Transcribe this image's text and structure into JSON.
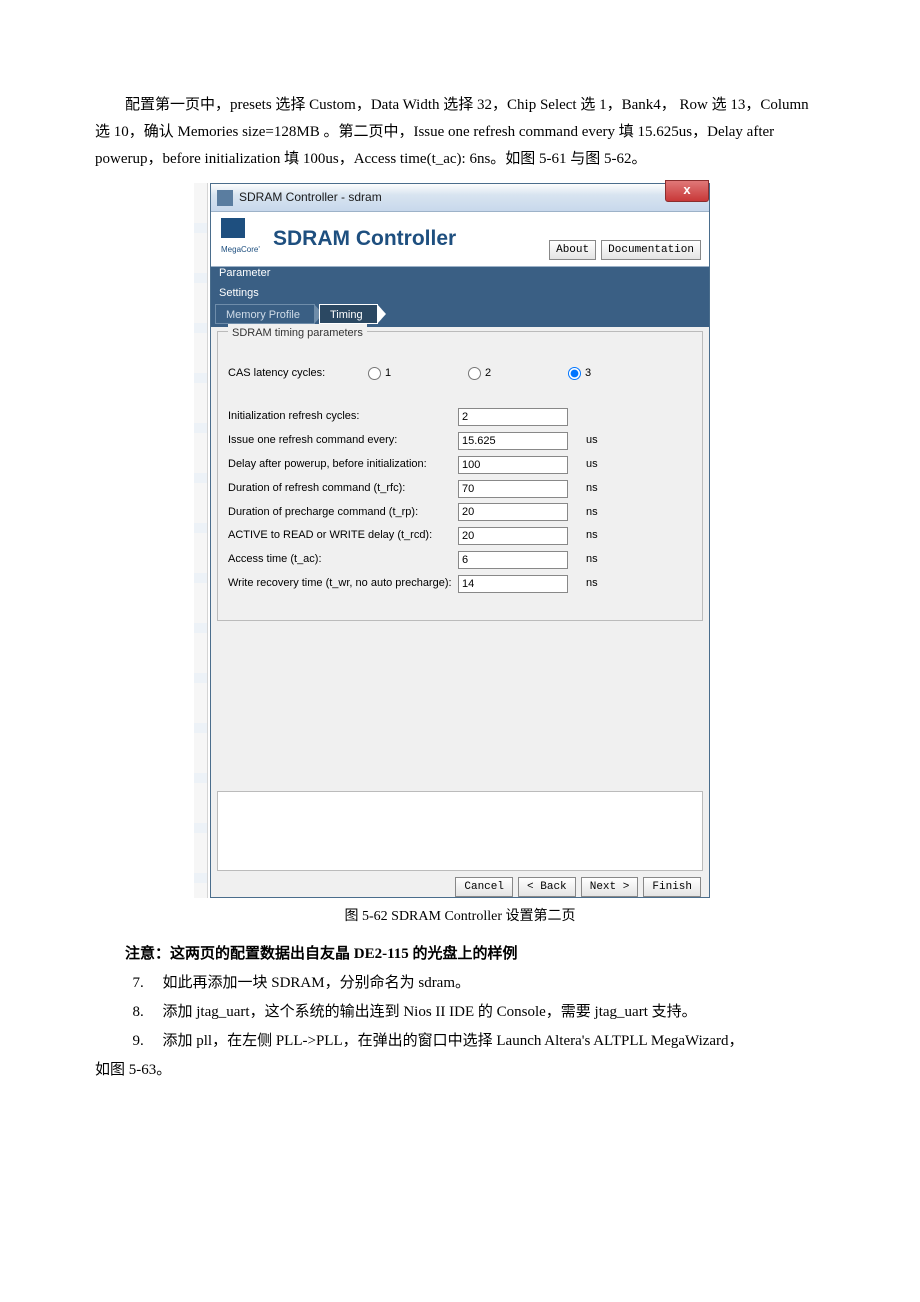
{
  "para1": "配置第一页中，presets 选择 Custom，Data Width 选择 32，Chip Select 选 1，Bank4， Row 选 13，Column 选 10，确认 Memories size=128MB 。第二页中，Issue one refresh command every 填 15.625us，Delay after powerup，before initialization 填 100us，Access time(t_ac): 6ns。如图 5-61 与图 5-62。",
  "dialog": {
    "titlebar": "SDRAM Controller - sdram",
    "close": "x",
    "logo_label": "MegaCore'",
    "big_title": "SDRAM Controller",
    "about_btn": "About",
    "doc_btn": "Documentation",
    "param_settings": "Parameter\nSettings",
    "crumb1": "Memory Profile",
    "crumb2": "Timing",
    "group_title": "SDRAM timing parameters",
    "cas_label": "CAS latency cycles:",
    "opt1": "1",
    "opt2": "2",
    "opt3": "3",
    "rows": [
      {
        "label": "Initialization refresh cycles:",
        "value": "2",
        "unit": ""
      },
      {
        "label": "Issue one refresh command every:",
        "value": "15.625",
        "unit": "us"
      },
      {
        "label": "Delay after powerup, before initialization:",
        "value": "100",
        "unit": "us"
      },
      {
        "label": "Duration of refresh command (t_rfc):",
        "value": "70",
        "unit": "ns"
      },
      {
        "label": "Duration of precharge command (t_rp):",
        "value": "20",
        "unit": "ns"
      },
      {
        "label": "ACTIVE to READ or WRITE delay (t_rcd):",
        "value": "20",
        "unit": "ns"
      },
      {
        "label": "Access time (t_ac):",
        "value": "6",
        "unit": "ns"
      },
      {
        "label": "Write recovery time (t_wr, no auto precharge):",
        "value": "14",
        "unit": "ns"
      }
    ],
    "cancel": "Cancel",
    "back": "< Back",
    "next": "Next >",
    "finish": "Finish"
  },
  "caption": "图 5-62 SDRAM Controller 设置第二页",
  "note": "注意：这两页的配置数据出自友晶 DE2-115 的光盘上的样例",
  "steps": {
    "s7": {
      "n": "7.",
      "t": "如此再添加一块 SDRAM，分别命名为 sdram。"
    },
    "s8": {
      "n": "8.",
      "t": "添加 jtag_uart，这个系统的输出连到 Nios II IDE 的 Console，需要 jtag_uart 支持。"
    },
    "s9": {
      "n": "9.",
      "t": "添加 pll，在左侧 PLL->PLL，在弹出的窗口中选择 Launch Altera's ALTPLL MegaWizard，"
    }
  },
  "tail": "如图 5-63。"
}
